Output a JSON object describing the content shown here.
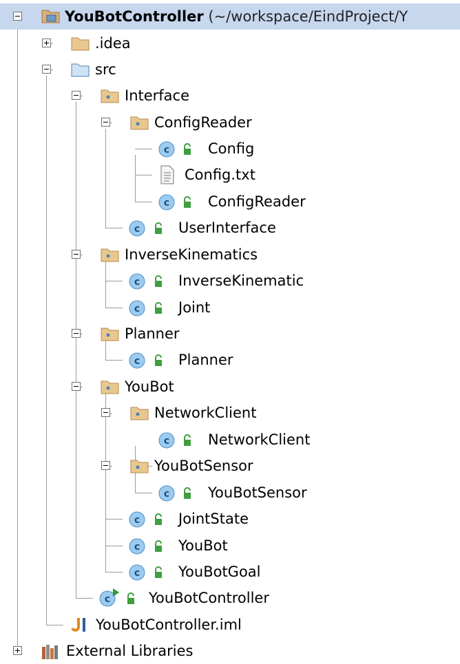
{
  "tree": {
    "root": {
      "label": "YouBotController",
      "path": " (~/workspace/EindProject/Y"
    },
    "idea": {
      "label": ".idea"
    },
    "src": {
      "label": "src"
    },
    "interface": {
      "label": "Interface"
    },
    "configreader_pkg": {
      "label": "ConfigReader"
    },
    "config_class": {
      "label": "Config"
    },
    "config_txt": {
      "label": "Config.txt"
    },
    "configreader_class": {
      "label": "ConfigReader"
    },
    "userinterface": {
      "label": "UserInterface"
    },
    "inversekinematics_pkg": {
      "label": "InverseKinematics"
    },
    "inversekinematic_class": {
      "label": "InverseKinematic"
    },
    "joint_class": {
      "label": "Joint"
    },
    "planner_pkg": {
      "label": "Planner"
    },
    "planner_class": {
      "label": "Planner"
    },
    "youbot_pkg": {
      "label": "YouBot"
    },
    "networkclient_pkg": {
      "label": "NetworkClient"
    },
    "networkclient_class": {
      "label": "NetworkClient"
    },
    "youbotsensor_pkg": {
      "label": "YouBotSensor"
    },
    "youbotsensor_class": {
      "label": "YouBotSensor"
    },
    "jointstate_class": {
      "label": "JointState"
    },
    "youbot_class": {
      "label": "YouBot"
    },
    "youbotgoal_class": {
      "label": "YouBotGoal"
    },
    "youbotcontroller_main": {
      "label": "YouBotController"
    },
    "iml_file": {
      "label": "YouBotController.iml"
    },
    "external_libraries": {
      "label": "External Libraries"
    }
  },
  "icons": {
    "module": "module-folder-icon",
    "folder": "folder-icon",
    "source_root": "source-folder-icon",
    "package": "package-icon",
    "class": "class-icon",
    "main_class": "runnable-class-icon",
    "access": "public-access-icon",
    "text_file": "text-file-icon",
    "iml": "module-file-icon",
    "library": "library-icon"
  },
  "colors": {
    "selection": "#c7d7ee",
    "class_badge": "#9ccbf0",
    "access_green": "#3f9e3f",
    "folder_brown": "#b8874e"
  }
}
